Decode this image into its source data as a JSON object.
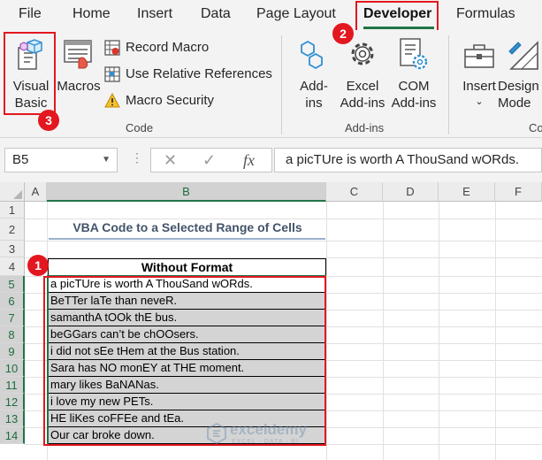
{
  "ribbon_tabs": [
    "File",
    "Home",
    "Insert",
    "Data",
    "Page Layout",
    "Developer",
    "Formulas"
  ],
  "active_tab": "Developer",
  "ribbon": {
    "code_group": {
      "visual_basic": [
        "Visual",
        "Basic"
      ],
      "macros": "Macros",
      "record_macro": "Record Macro",
      "use_relative_references": "Use Relative References",
      "macro_security": "Macro Security",
      "label": "Code"
    },
    "addins_group": {
      "addins": [
        "Add-",
        "ins"
      ],
      "excel_addins": [
        "Excel",
        "Add-ins"
      ],
      "com_addins": [
        "COM",
        "Add-ins"
      ],
      "label": "Add-ins"
    },
    "controls_group": {
      "insert": "Insert",
      "design_mode": [
        "Design",
        "Mode"
      ],
      "label": "Co"
    }
  },
  "annotations": {
    "badge_1": "1",
    "badge_2": "2",
    "badge_3": "3"
  },
  "formula_bar": {
    "name_box": "B5",
    "cancel_symbol": "✕",
    "enter_symbol": "✓",
    "fx_symbol": "fx",
    "content": "a picTUre is worth A ThouSand wORds."
  },
  "sheet": {
    "columns": [
      "A",
      "B",
      "C",
      "D",
      "E",
      "F"
    ],
    "rows": [
      "1",
      "2",
      "3",
      "4",
      "5",
      "6",
      "7",
      "8",
      "9",
      "10",
      "11",
      "12",
      "13",
      "14"
    ],
    "selected_cell": "B5",
    "title": "VBA Code to a Selected Range of Cells",
    "table_header": "Without Format",
    "table_values": [
      "a picTUre is worth A ThouSand wORds.",
      "BeTTer laTe than neveR.",
      "samanthA tOOk thE bus.",
      "beGGars can’t be chOOsers.",
      "i did not sEe tHem at the Bus station.",
      "Sara has NO monEY at THE moment.",
      "mary likes BaNANas.",
      "i love my new PETs.",
      "HE liKes coFFEe and tEa.",
      "Our car broke down."
    ]
  },
  "watermark": {
    "name": "exceldemy",
    "tagline": "EXCEL · DATA · BI"
  },
  "colors": {
    "accent_green": "#217346",
    "annotation_red": "#e3171f",
    "title_blue": "#44546a"
  }
}
